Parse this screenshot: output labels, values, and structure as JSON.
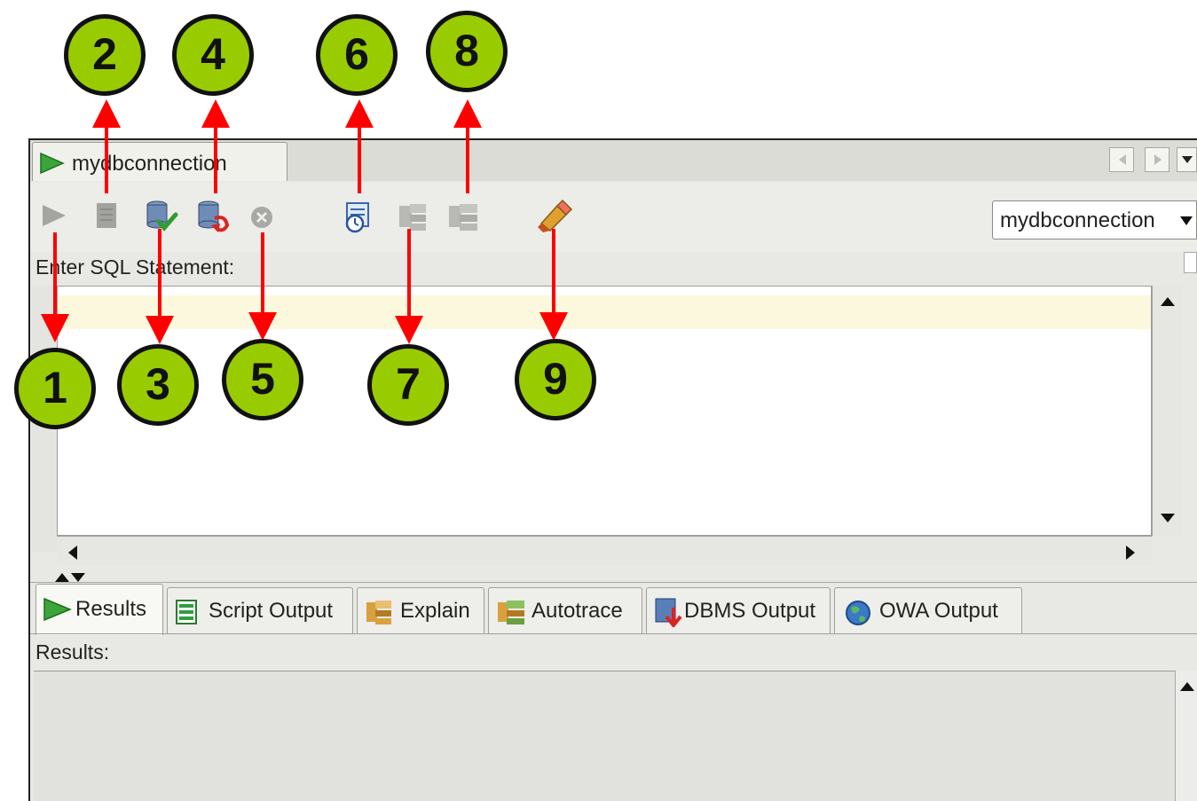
{
  "editor_tab": {
    "label": "mydbconnection"
  },
  "connection_select": {
    "value": "mydbconnection"
  },
  "sql_panel": {
    "label": "Enter SQL Statement:"
  },
  "toolbar": {
    "buttons": [
      {
        "name": "run-statement",
        "icon": "play-icon"
      },
      {
        "name": "run-script",
        "icon": "script-icon"
      },
      {
        "name": "commit",
        "icon": "commit-icon"
      },
      {
        "name": "rollback",
        "icon": "rollback-icon"
      },
      {
        "name": "cancel",
        "icon": "cancel-icon"
      },
      {
        "name": "sql-history",
        "icon": "history-icon"
      },
      {
        "name": "explain-plan",
        "icon": "explain-icon"
      },
      {
        "name": "autotrace",
        "icon": "autotrace-icon"
      },
      {
        "name": "clear",
        "icon": "eraser-icon"
      }
    ]
  },
  "results_tabs": [
    {
      "label": "Results",
      "icon": "play-icon",
      "active": true
    },
    {
      "label": "Script Output",
      "icon": "script-output-icon"
    },
    {
      "label": "Explain",
      "icon": "explain-icon"
    },
    {
      "label": "Autotrace",
      "icon": "autotrace-icon"
    },
    {
      "label": "DBMS Output",
      "icon": "dbms-output-icon"
    },
    {
      "label": "OWA Output",
      "icon": "globe-icon"
    }
  ],
  "results_panel": {
    "label": "Results:"
  },
  "callouts": [
    "1",
    "2",
    "3",
    "4",
    "5",
    "6",
    "7",
    "8",
    "9"
  ],
  "colors": {
    "callout": "#99cc00",
    "arrow": "#ff0000",
    "current_line": "#fbf8dd"
  }
}
